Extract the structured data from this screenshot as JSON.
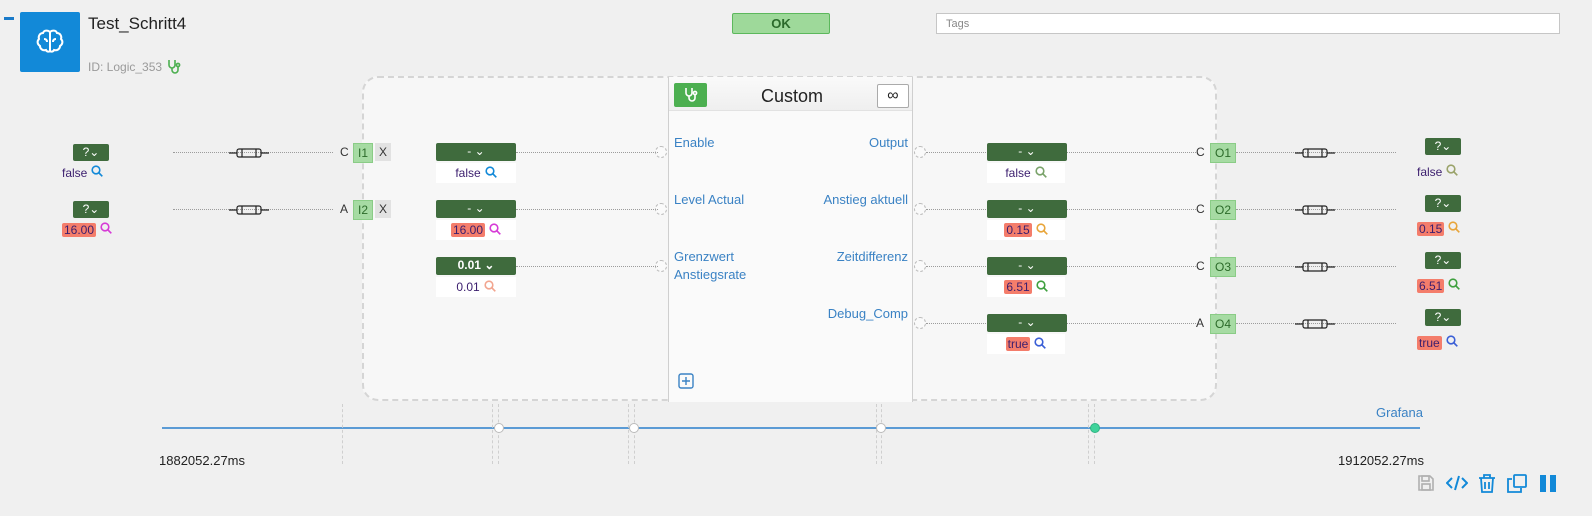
{
  "header": {
    "title": "Test_Schritt4",
    "id_label": "ID: Logic_353",
    "status": "OK",
    "tags_placeholder": "Tags"
  },
  "block": {
    "name": "Custom",
    "inf_symbol": "∞",
    "inputs": [
      {
        "label": "Enable"
      },
      {
        "label": "Level Actual"
      },
      {
        "label": "Grenzwert Anstiegsrate"
      }
    ],
    "outputs": [
      {
        "label": "Output"
      },
      {
        "label": "Anstieg aktuell"
      },
      {
        "label": "Zeitdifferenz"
      },
      {
        "label": "Debug_Comp"
      }
    ]
  },
  "left_sources": [
    {
      "dropdown": "?⌄",
      "value": "false",
      "mode": "C",
      "port": "I1",
      "x": "X"
    },
    {
      "dropdown": "?⌄",
      "value": "16.00",
      "mode": "A",
      "port": "I2",
      "x": "X"
    }
  ],
  "left_inputs": [
    {
      "dropdown": "- ⌄",
      "value": "false"
    },
    {
      "dropdown": "- ⌄",
      "value": "16.00"
    },
    {
      "dropdown": "0.01 ⌄",
      "value": "0.01"
    }
  ],
  "right_outputs": [
    {
      "dropdown": "- ⌄",
      "value": "false",
      "mode": "C",
      "port": "O1"
    },
    {
      "dropdown": "- ⌄",
      "value": "0.15",
      "mode": "C",
      "port": "O2"
    },
    {
      "dropdown": "- ⌄",
      "value": "6.51",
      "mode": "C",
      "port": "O3"
    },
    {
      "dropdown": "- ⌄",
      "value": "true",
      "mode": "A",
      "port": "O4"
    }
  ],
  "right_targets": [
    {
      "dropdown": "?⌄",
      "value": "false"
    },
    {
      "dropdown": "?⌄",
      "value": "0.15"
    },
    {
      "dropdown": "?⌄",
      "value": "6.51"
    },
    {
      "dropdown": "?⌄",
      "value": "true"
    }
  ],
  "timeline": {
    "start": "1882052.27ms",
    "end": "1912052.27ms",
    "link": "Grafana"
  },
  "colors": {
    "accent_blue": "#1289d8",
    "node_green": "#3f6b3d",
    "ok_green": "#9ed99a",
    "highlight_red": "#f47d6b",
    "link_blue": "#3a82c4"
  },
  "icons": [
    "brain-icon",
    "stethoscope-icon",
    "infinity-icon",
    "plus-square-icon",
    "magnifier-icon",
    "connector-icon",
    "save-icon",
    "code-icon",
    "trash-icon",
    "copy-icon",
    "pause-icon"
  ]
}
